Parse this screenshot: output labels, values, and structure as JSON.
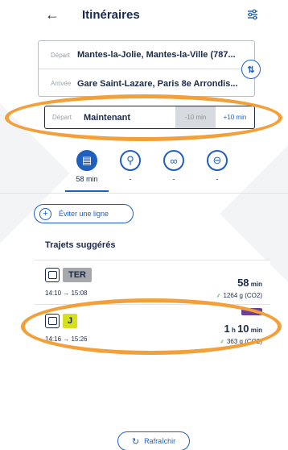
{
  "header": {
    "title": "Itinéraires",
    "back_icon": "arrow-left-icon",
    "filter_icon": "sliders-icon"
  },
  "route": {
    "depart_label": "Départ",
    "depart_value": "Mantes-la-Jolie, Mantes-la-Ville (787...",
    "arrivee_label": "Arrivée",
    "arrivee_value": "Gare Saint-Lazare, Paris 8e Arrondis...",
    "swap_icon": "swap-vertical-icon"
  },
  "time": {
    "label": "Départ",
    "value": "Maintenant",
    "minus": "-10 min",
    "plus": "+10 min"
  },
  "modes": [
    {
      "icon": "train-bus-icon",
      "duration": "58 min",
      "active": true
    },
    {
      "icon": "walk-icon",
      "duration": "-",
      "active": false
    },
    {
      "icon": "bike-icon",
      "duration": "-",
      "active": false
    },
    {
      "icon": "car-icon",
      "duration": "-",
      "active": false
    }
  ],
  "avoid_button": "Éviter une ligne",
  "section_title": "Trajets suggérés",
  "journeys": [
    {
      "line": "TER",
      "times": "14:10 → 15:08",
      "duration_main": "58",
      "duration_unit": "min",
      "co2": "1264 g (CO2)"
    },
    {
      "line": "J",
      "times": "14:16 → 15:26",
      "duration_hours": "1",
      "duration_h": "h",
      "duration_main": "10",
      "duration_unit": "min",
      "co2": "363 g (CO2)"
    }
  ],
  "refresh_button": "Rafraîchir",
  "colors": {
    "accent": "#1f5fbf",
    "highlight": "#f2a03a",
    "ter_badge": "#a6a8ab",
    "j_badge": "#d6e01c"
  }
}
